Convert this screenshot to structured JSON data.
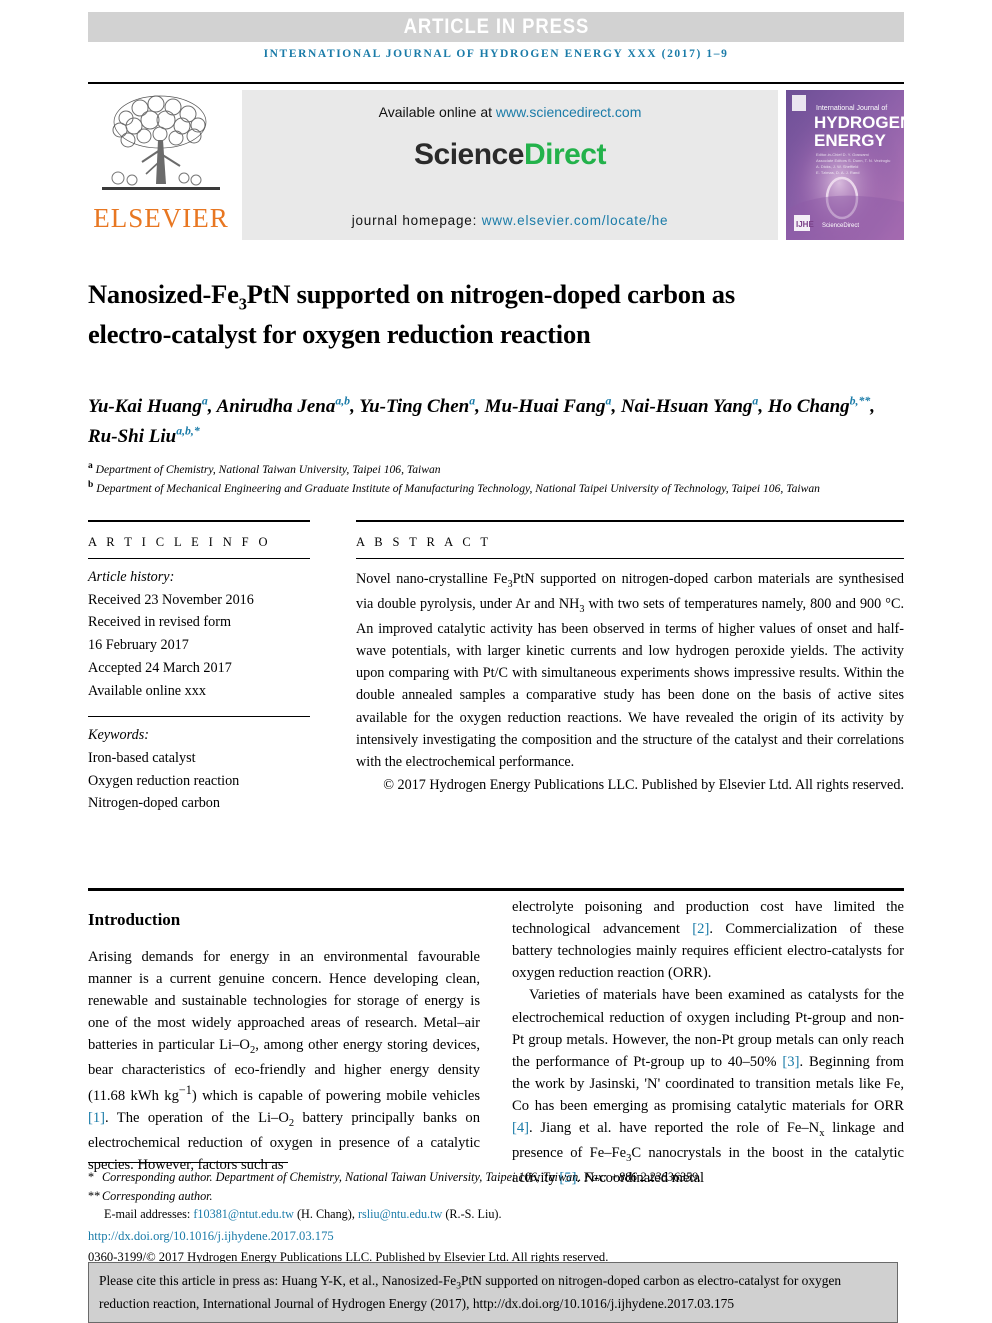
{
  "banner": {
    "text": "ARTICLE IN PRESS"
  },
  "running_head": {
    "text": "INTERNATIONAL JOURNAL OF HYDROGEN ENERGY XXX (2017) 1–9"
  },
  "masthead": {
    "available_online_label": "Available online at",
    "sciencedirect_url": "www.sciencedirect.com",
    "logo_part1": "Science",
    "logo_part2": "Direct",
    "homepage_label": "journal homepage:",
    "homepage_url": "www.elsevier.com/locate/he",
    "publisher": "ELSEVIER",
    "cover": {
      "line1": "International Journal of",
      "line2": "HYDROGEN",
      "line3": "ENERGY",
      "footer": "ScienceDirect"
    }
  },
  "title": {
    "line1_a": "Nanosized-Fe",
    "line1_sub": "3",
    "line1_b": "PtN supported on nitrogen-doped",
    "line2": "carbon as electro-catalyst for oxygen reduction",
    "line3": "reaction"
  },
  "authors": {
    "line1": "Yu-Kai Huang ᵃ, Anirudha Jena ᵃᵇ, Yu-Ting Chen ᵃ, Mu-Huai Fang ᵃ,",
    "line2": "Nai-Hsuan Yang ᵃ, Ho Chang ᵇ**, Ru-Shi Liu ᵃᵇ*",
    "names": [
      {
        "name": "Yu-Kai Huang",
        "marks": "a"
      },
      {
        "name": "Anirudha Jena",
        "marks": "a,b"
      },
      {
        "name": "Yu-Ting Chen",
        "marks": "a"
      },
      {
        "name": "Mu-Huai Fang",
        "marks": "a"
      },
      {
        "name": "Nai-Hsuan Yang",
        "marks": "a"
      },
      {
        "name": "Ho Chang",
        "marks": "b,**"
      },
      {
        "name": "Ru-Shi Liu",
        "marks": "a,b,*"
      }
    ],
    "affiliations": [
      {
        "mark": "a",
        "text": "Department of Chemistry, National Taiwan University, Taipei 106, Taiwan"
      },
      {
        "mark": "b",
        "text": "Department of Mechanical Engineering and Graduate Institute of Manufacturing Technology, National Taipei University of Technology, Taipei 106, Taiwan"
      }
    ]
  },
  "article_info": {
    "label": "A R T I C L E   I N F O",
    "history_label": "Article history:",
    "history": [
      "Received 23 November 2016",
      "Received in revised form",
      "16 February 2017",
      "Accepted 24 March 2017",
      "Available online xxx"
    ],
    "keywords_label": "Keywords:",
    "keywords": [
      "Iron-based catalyst",
      "Oxygen reduction reaction",
      "Nitrogen-doped carbon"
    ]
  },
  "abstract": {
    "label": "A B S T R A C T",
    "part1": "Novel nano-crystalline Fe",
    "sub1": "3",
    "part2": "PtN supported on nitrogen-doped carbon materials are synthesised via double pyrolysis, under Ar and NH",
    "sub2": "3",
    "part3": " with two sets of temperatures namely, 800 and 900 °C. An improved catalytic activity has been observed in terms of higher values of onset and half-wave potentials, with larger kinetic currents and low hydrogen peroxide yields. The activity upon comparing with Pt/C with simultaneous experiments shows impressive results. Within the double annealed samples a comparative study has been done on the basis of active sites available for the oxygen reduction reactions. We have revealed the origin of its activity by intensively investigating the composition and the structure of the catalyst and their correlations with the electrochemical performance.",
    "copyright": "© 2017 Hydrogen Energy Publications LLC. Published by Elsevier Ltd. All rights reserved."
  },
  "body": {
    "heading": "Introduction",
    "left_para_1a": "Arising demands for energy in an environmental favourable manner is a current genuine concern. Hence developing clean, renewable and sustainable technologies for storage of energy is one of the most widely approached areas of research. Metal–air batteries in particular Li–O",
    "left_sub1": "2",
    "left_para_1b": ", among other energy storing devices, bear characteristics of eco-friendly and higher energy density (11.68 kWh kg",
    "left_sup1": "−1",
    "left_para_1c": ") which is capable of powering mobile vehicles ",
    "left_ref1": "[1]",
    "left_para_1d": ". The operation of the Li–O",
    "left_sub2": "2",
    "left_para_1e": " battery principally banks on electrochemical reduction of oxygen in presence of a catalytic species. However, factors such as",
    "right_para_1a": "electrolyte poisoning and production cost have limited the technological advancement ",
    "right_ref1": "[2]",
    "right_para_1b": ". Commercialization of these battery technologies mainly requires efficient electro-catalysts for oxygen reduction reaction (ORR).",
    "right_para_2a": "Varieties of materials have been examined as catalysts for the electrochemical reduction of oxygen including Pt-group and non-Pt group metals. However, the non-Pt group metals can only reach the performance of Pt-group up to 40–50% ",
    "right_ref2": "[3]",
    "right_para_2b": ". Beginning from the work by Jasinski, 'N' coordinated to transition metals like Fe, Co has been emerging as promising catalytic materials for ORR ",
    "right_ref3": "[4]",
    "right_para_2c": ". Jiang et al. have reported the role of Fe–N",
    "right_sub1": "x",
    "right_para_2d": " linkage and presence of Fe–Fe",
    "right_sub2": "3",
    "right_para_2e": "C nanocrystals in the boost in the catalytic activity ",
    "right_ref4": "[5]",
    "right_para_2f": ". N-coordinated metal"
  },
  "footnotes": {
    "star_mark": "*",
    "star_text": "Corresponding author. Department of Chemistry, National Taiwan University, Taipei 106, Taiwan. Fax: +886 2 23636359.",
    "dstar_mark": "**",
    "dstar_text": "Corresponding author.",
    "email_label": "E-mail addresses:",
    "email1": "f10381@ntut.edu.tw",
    "email1_owner": "(H. Chang)",
    "email2": "rsliu@ntu.edu.tw",
    "email2_owner": "(R.-S. Liu)",
    "doi": "http://dx.doi.org/10.1016/j.ijhydene.2017.03.175",
    "issn_line": "0360-3199/© 2017 Hydrogen Energy Publications LLC. Published by Elsevier Ltd. All rights reserved."
  },
  "cite_box": {
    "part1": "Please cite this article in press as: Huang Y-K, et al., Nanosized-Fe",
    "sub": "3",
    "part2": "PtN supported on nitrogen-doped carbon as electro-catalyst for oxygen reduction reaction, International Journal of Hydrogen Energy (2017), http://dx.doi.org/10.1016/j.ijhydene.2017.03.175"
  },
  "colors": {
    "link": "#1a7ba8",
    "elsevier_orange": "#e87722",
    "sciencedirect_green": "#23b24b",
    "banner_gray": "#d2d2d2",
    "cite_box_gray": "#d0d0d0"
  }
}
